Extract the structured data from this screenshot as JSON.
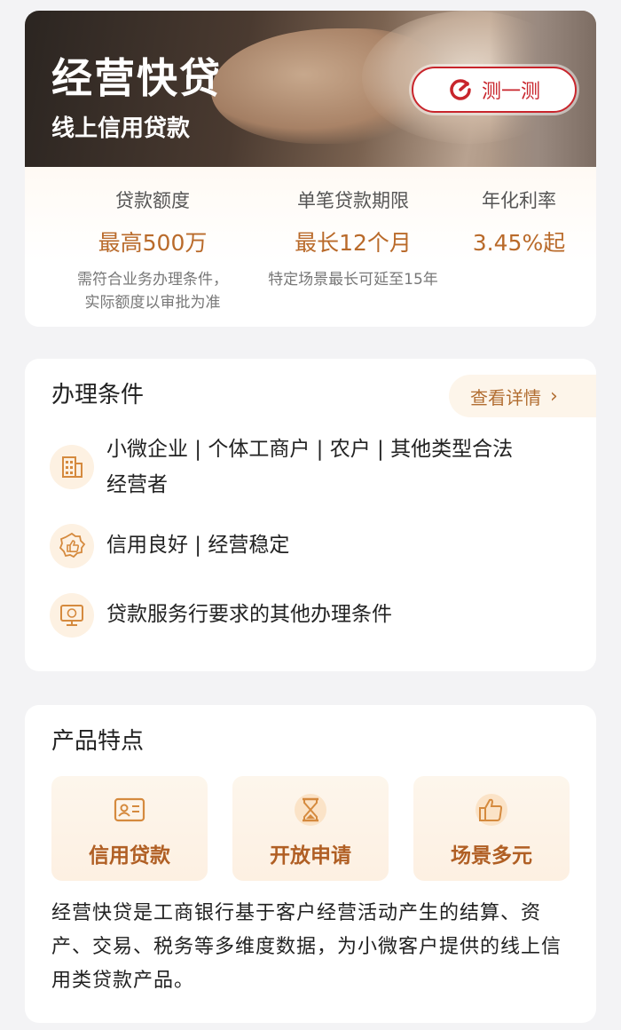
{
  "hero": {
    "title": "经营快贷",
    "subtitle": "线上信用贷款",
    "test_button": "测一测",
    "stats": [
      {
        "label": "贷款额度",
        "value": "最高500万",
        "note_line1": "需符合业务办理条件，",
        "note_line2": "实际额度以审批为准"
      },
      {
        "label": "单笔贷款期限",
        "value": "最长12个月",
        "note_line1": "特定场景最长可延至15年",
        "note_line2": ""
      },
      {
        "label": "年化利率",
        "value": "3.45%起",
        "note_line1": "",
        "note_line2": ""
      }
    ]
  },
  "conditions": {
    "title": "办理条件",
    "detail_button": "查看详情",
    "items": [
      {
        "text_line1": "小微企业 | 个体工商户 | 农户 | 其他类型合法",
        "text_line2": "经营者",
        "icon": "building-icon"
      },
      {
        "text_line1": "信用良好 | 经营稳定",
        "icon": "thumbs-up-badge-icon"
      },
      {
        "text_line1": "贷款服务行要求的其他办理条件",
        "icon": "monitor-icon"
      }
    ]
  },
  "features": {
    "title": "产品特点",
    "tiles": [
      {
        "label": "信用贷款",
        "icon": "id-card-icon"
      },
      {
        "label": "开放申请",
        "icon": "hourglass-icon"
      },
      {
        "label": "场景多元",
        "icon": "thumbs-up-icon"
      }
    ],
    "description": "经营快贷是工商银行基于客户经营活动产生的结算、资产、交易、税务等多维度数据，为小微客户提供的线上信用类贷款产品。"
  },
  "colors": {
    "accent": "#b96a2a",
    "brand_red": "#c8252c",
    "tile_bg": "#fdf3e6"
  }
}
